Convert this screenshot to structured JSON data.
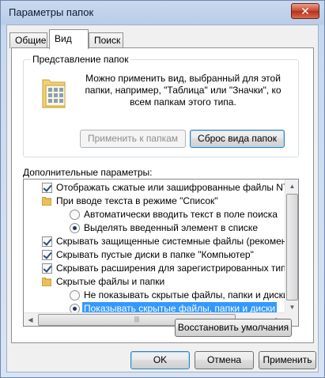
{
  "window": {
    "title": "Параметры папок",
    "close_glyph": "✕"
  },
  "tabs": [
    {
      "label": "Общие",
      "active": false
    },
    {
      "label": "Вид",
      "active": true
    },
    {
      "label": "Поиск",
      "active": false
    }
  ],
  "folder_views": {
    "group_label": "Представление папок",
    "description": "Можно применить вид, выбранный для этой папки, например, \"Таблица\" или \"Значки\", ко всем папкам этого типа.",
    "apply_button": "Применить к папкам",
    "reset_button": "Сброс вида папок",
    "icon": "folder-view-icon"
  },
  "advanced": {
    "label": "Дополнительные параметры:",
    "items": [
      {
        "type": "checkbox",
        "checked": true,
        "indent": 1,
        "text": "Отображать сжатые или зашифрованные файлы NTFS"
      },
      {
        "type": "folder",
        "indent": 1,
        "text": "При вводе текста в режиме \"Список\""
      },
      {
        "type": "radio",
        "checked": false,
        "indent": 2,
        "text": "Автоматически вводить текст в поле поиска"
      },
      {
        "type": "radio",
        "checked": true,
        "indent": 2,
        "text": "Выделять введенный элемент в списке"
      },
      {
        "type": "checkbox",
        "checked": true,
        "indent": 1,
        "text": "Скрывать защищенные системные файлы (рекомендуется)"
      },
      {
        "type": "checkbox",
        "checked": true,
        "indent": 1,
        "text": "Скрывать пустые диски в папке \"Компьютер\""
      },
      {
        "type": "checkbox",
        "checked": true,
        "indent": 1,
        "text": "Скрывать расширения для зарегистрированных типов файлов"
      },
      {
        "type": "folder",
        "indent": 1,
        "text": "Скрытые файлы и папки"
      },
      {
        "type": "radio",
        "checked": false,
        "indent": 2,
        "text": "Не показывать скрытые файлы, папки и диски"
      },
      {
        "type": "radio",
        "checked": true,
        "indent": 2,
        "selected": true,
        "text": "Показывать скрытые файлы, папки и диски"
      }
    ]
  },
  "restore_button": "Восстановить умолчания",
  "footer": {
    "ok": "OK",
    "cancel": "Отмена",
    "apply": "Применить"
  },
  "colors": {
    "selection": "#3399ff",
    "accent": "#3c7fb1"
  }
}
